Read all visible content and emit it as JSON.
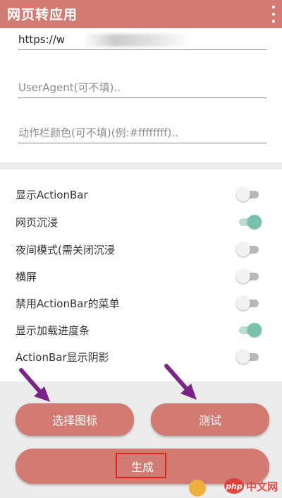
{
  "app_bar": {
    "title": "网页转应用",
    "menu_icon": "more-vert-icon"
  },
  "form": {
    "url_value": "https://w",
    "useragent_placeholder": "UserAgent(可不填)..",
    "actionbar_color_placeholder": "动作栏颜色(可不填)(例:#ffffffff).."
  },
  "switches": [
    {
      "label": "显示ActionBar",
      "on": false
    },
    {
      "label": "网页沉浸",
      "on": true
    },
    {
      "label": "夜间模式(需关闭沉浸",
      "on": false
    },
    {
      "label": "横屏",
      "on": false
    },
    {
      "label": "禁用ActionBar的菜单",
      "on": false
    },
    {
      "label": "显示加载进度条",
      "on": true
    },
    {
      "label": "ActionBar显示阴影",
      "on": false
    }
  ],
  "buttons": {
    "pick_icon": "选择图标",
    "test": "测试",
    "generate": "生成"
  },
  "watermark": {
    "logo": "php",
    "text": "中文网"
  },
  "colors": {
    "primary": "#d17b73",
    "switch_on": "#78c2ad",
    "arrow": "#7a2585",
    "highlight": "#e0231f"
  }
}
